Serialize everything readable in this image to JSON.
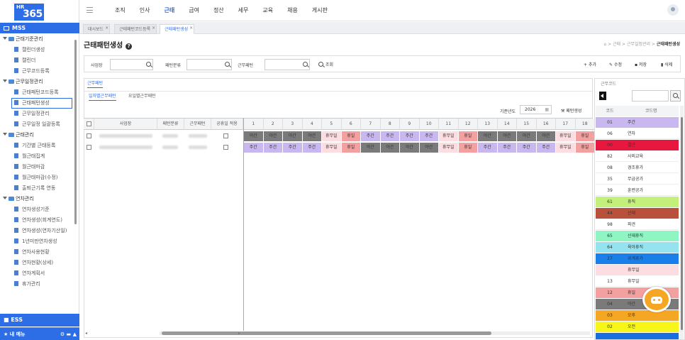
{
  "logo": {
    "top": "HR",
    "main": "365"
  },
  "sidebar": {
    "section": "MSS",
    "tree": [
      {
        "t": "g",
        "label": "근태기준관리"
      },
      {
        "t": "c",
        "label": "캘린더생성"
      },
      {
        "t": "c",
        "label": "캘린더"
      },
      {
        "t": "c",
        "label": "근무코드등록"
      },
      {
        "t": "g",
        "label": "근무일정관리"
      },
      {
        "t": "c",
        "label": "근태패턴코드등록"
      },
      {
        "t": "c",
        "label": "근태패턴생성",
        "sel": true
      },
      {
        "t": "c",
        "label": "근무일정관리"
      },
      {
        "t": "c",
        "label": "근무일정 일괄등록"
      },
      {
        "t": "g",
        "label": "근태관리"
      },
      {
        "t": "c",
        "label": "기간별 근태등록"
      },
      {
        "t": "c",
        "label": "월근태집계"
      },
      {
        "t": "c",
        "label": "월근태마감"
      },
      {
        "t": "c",
        "label": "월근태마감(수정)"
      },
      {
        "t": "c",
        "label": "출퇴근기록 연동"
      },
      {
        "t": "g",
        "label": "연차관리"
      },
      {
        "t": "c",
        "label": "연차생성기준"
      },
      {
        "t": "c",
        "label": "연차생성(회계연도)"
      },
      {
        "t": "c",
        "label": "연차생성(연차기산일)"
      },
      {
        "t": "c",
        "label": "1년미만연차생성"
      },
      {
        "t": "c",
        "label": "연차사용현황"
      },
      {
        "t": "c",
        "label": "연차현황(상세)"
      },
      {
        "t": "c",
        "label": "연차계획서"
      },
      {
        "t": "c",
        "label": "휴가관리"
      }
    ],
    "ess": "ESS",
    "mymenu": "내 메뉴"
  },
  "topmenu": [
    {
      "label": "조직"
    },
    {
      "label": "인사"
    },
    {
      "label": "근태",
      "active": true
    },
    {
      "label": "급여"
    },
    {
      "label": "정산"
    },
    {
      "label": "세무"
    },
    {
      "label": "교육"
    },
    {
      "label": "채용"
    },
    {
      "label": "게시판"
    }
  ],
  "tabs": [
    {
      "label": "대시보드"
    },
    {
      "label": "근태패턴코드등록"
    },
    {
      "label": "근태패턴생성",
      "active": true
    }
  ],
  "page": {
    "title": "근태패턴생성",
    "breadcrumb": "근태 > 근무일정관리 > ",
    "breadcrumb_current": "근태패턴생성"
  },
  "search": {
    "l1": "사업장",
    "l2": "패턴분류",
    "l3": "근무패턴",
    "btn": "조회",
    "add": "추가",
    "edit": "수정",
    "save": "저장",
    "del": "삭제"
  },
  "panel": {
    "label": "근무패턴",
    "sub1": "일자별근무패턴",
    "sub2": "요일별근무패턴",
    "yearLabel": "기준년도",
    "year": "2026",
    "genBtn": "패턴생성"
  },
  "grid": {
    "cols": [
      "사업장",
      "패턴분류",
      "근무패턴",
      "공휴일 적용"
    ],
    "days": [
      "1",
      "2",
      "3",
      "4",
      "5",
      "6",
      "7",
      "8",
      "9",
      "10",
      "11",
      "12",
      "13",
      "14",
      "15",
      "16",
      "17",
      "18"
    ],
    "rows": [
      [
        "야간",
        "야간",
        "야간",
        "야간",
        "휴무일",
        "휴일",
        "주간",
        "주간",
        "주간",
        "주간",
        "휴무일",
        "휴일",
        "야간",
        "야간",
        "야간",
        "야간",
        "휴무일",
        "휴일"
      ],
      [
        "주간",
        "주간",
        "주간",
        "주간",
        "휴무일",
        "휴일",
        "야간",
        "야간",
        "야간",
        "야간",
        "휴무일",
        "휴일",
        "주간",
        "주간",
        "주간",
        "주간",
        "휴무일",
        "휴일"
      ]
    ]
  },
  "codes": {
    "title": "근무코드",
    "head": [
      "코드",
      "코드명"
    ],
    "list": [
      {
        "c": "01",
        "n": "주간",
        "bg": "#c9b8f0"
      },
      {
        "c": "06",
        "n": "연차",
        "bg": "#ffffff"
      },
      {
        "c": "00",
        "n": "결근",
        "bg": "#e8173f"
      },
      {
        "c": "82",
        "n": "사외교육",
        "bg": "#ffffff"
      },
      {
        "c": "08",
        "n": "경조휴가",
        "bg": "#ffffff"
      },
      {
        "c": "35",
        "n": "무급공가",
        "bg": "#ffffff"
      },
      {
        "c": "39",
        "n": "훈련공가",
        "bg": "#ffffff"
      },
      {
        "c": "61",
        "n": "휴직",
        "bg": "#c3f07a"
      },
      {
        "c": "44",
        "n": "산재",
        "bg": "#b8503c"
      },
      {
        "c": "98",
        "n": "파견",
        "bg": "#ffffff"
      },
      {
        "c": "65",
        "n": "산재휴직",
        "bg": "#8ff5c3"
      },
      {
        "c": "64",
        "n": "육아휴직",
        "bg": "#94e3ef"
      },
      {
        "c": "27",
        "n": "위계휴가",
        "bg": "#1a7fe8"
      },
      {
        "c": "",
        "n": "휴무일",
        "bg": "#fcdde1"
      },
      {
        "c": "13",
        "n": "휴무일",
        "bg": "#ffffff"
      },
      {
        "c": "12",
        "n": "휴일",
        "bg": "#f3a0a0"
      },
      {
        "c": "04",
        "n": "야간",
        "bg": "#7a7a7a"
      },
      {
        "c": "03",
        "n": "오후",
        "bg": "#f5a623"
      },
      {
        "c": "02",
        "n": "오전",
        "bg": "#f6f61a"
      },
      {
        "c": "",
        "n": "",
        "bg": "#1a6fe0"
      }
    ]
  },
  "colors": {
    "주간": "#c9b8f0",
    "야간": "#7a7a7a",
    "휴무일": "#fcdde1",
    "휴일": "#f3a0a0"
  }
}
